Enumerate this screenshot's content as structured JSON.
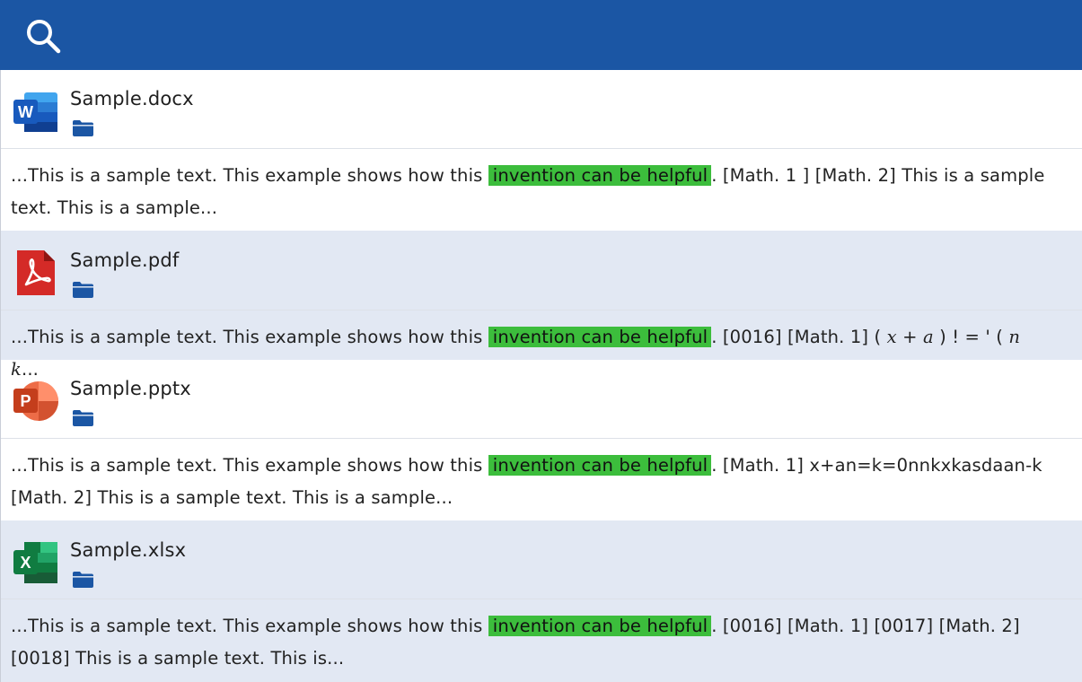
{
  "header": {
    "search_icon": "search-icon",
    "background_color": "#1b56a4"
  },
  "results": [
    {
      "file_name": "Sample.docx",
      "file_type": "word",
      "snippet_before": "...This is a sample text. This example shows how this ",
      "highlight": "invention can be helpful",
      "snippet_after": ". [Math. 1 ] [Math. 2] This is a sample text. This is a sample..."
    },
    {
      "file_name": "Sample.pdf",
      "file_type": "pdf",
      "snippet_before": "...This is a sample text. This example shows how this ",
      "highlight": "invention can be helpful",
      "snippet_after_a": ". [0016] [Math. 1] ( ",
      "snippet_math_x": "x",
      "snippet_after_b": " + ",
      "snippet_math_a": "a",
      "snippet_after_c": " ) ! = ' ( ",
      "snippet_math_nk": "n k",
      "snippet_after_d": "..."
    },
    {
      "file_name": "Sample.pptx",
      "file_type": "powerpoint",
      "snippet_before": "...This is a sample text. This example shows how this ",
      "highlight": "invention can be helpful",
      "snippet_after": ". [Math. 1] x+an=k=0nnkxkasdaan-k [Math. 2] This is a sample text. This is a sample..."
    },
    {
      "file_name": "Sample.xlsx",
      "file_type": "excel",
      "snippet_before": "...This is a sample text. This example shows how this ",
      "highlight": "invention can be helpful",
      "snippet_after": ". [0016] [Math. 1] [0017] [Math. 2] [0018] This is a sample text. This is..."
    }
  ],
  "colors": {
    "highlight": "#3cbd3c",
    "folder": "#1b56a4",
    "tint_row": "#e2e8f3"
  }
}
